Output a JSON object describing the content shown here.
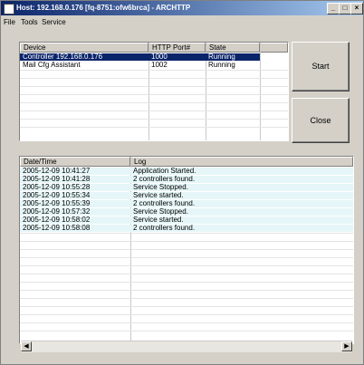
{
  "window": {
    "title": "Host: 192.168.0.176 [fq-8751:ofw6brca] - ARCHTTP",
    "minimize_label": "_",
    "close_label": "×",
    "restore_label": "□"
  },
  "menu": [
    "File",
    "Tools",
    "Service"
  ],
  "services_table": {
    "columns": [
      "Device",
      "HTTP Port#",
      "State"
    ],
    "rows": [
      {
        "device": "Controller 192.168.0.176",
        "port": "1000",
        "state": "Running"
      },
      {
        "device": "Mail Cfg Assistant",
        "port": "1002",
        "state": "Running"
      }
    ],
    "selected_index": 0
  },
  "buttons": {
    "start_label": "Start",
    "close_label": "Close"
  },
  "log_table": {
    "columns": [
      "Date/Time",
      "Log"
    ],
    "rows": [
      {
        "time": "2005-12-09 10:41:27",
        "log": "Application Started."
      },
      {
        "time": "2005-12-09 10:41:28",
        "log": "2 controllers found."
      },
      {
        "time": "2005-12-09 10:55:28",
        "log": "Service Stopped."
      },
      {
        "time": "2005-12-09 10:55:34",
        "log": "Service started."
      },
      {
        "time": "2005-12-09 10:55:39",
        "log": "2 controllers found."
      },
      {
        "time": "2005-12-09 10:57:32",
        "log": "Service Stopped."
      },
      {
        "time": "2005-12-09 10:58:02",
        "log": "Service started."
      },
      {
        "time": "2005-12-09 10:58:08",
        "log": "2 controllers found."
      }
    ]
  },
  "scrollbar": {
    "left_arrow": "◀",
    "right_arrow": "▶"
  },
  "colors": {
    "selection": "#0a246a",
    "row_alt": "#e6f6f8",
    "title_gradient_start": "#0a246a"
  }
}
